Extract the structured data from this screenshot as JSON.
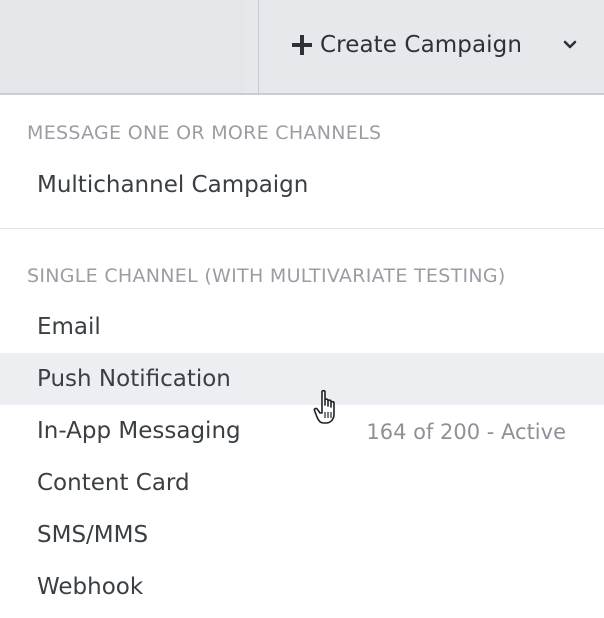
{
  "toolbar": {
    "create_label": "Create Campaign",
    "plus_icon": "plus-icon",
    "chevron_icon": "chevron-down-icon"
  },
  "menu": {
    "sections": [
      {
        "header": "MESSAGE ONE OR MORE CHANNELS",
        "items": [
          {
            "label": "Multichannel Campaign",
            "meta": ""
          }
        ]
      },
      {
        "header": "SINGLE CHANNEL (WITH MULTIVARIATE TESTING)",
        "items": [
          {
            "label": "Email",
            "meta": ""
          },
          {
            "label": "Push Notification",
            "meta": "",
            "hovered": true
          },
          {
            "label": "In-App Messaging",
            "meta": "164 of 200 - Active"
          },
          {
            "label": "Content Card",
            "meta": ""
          },
          {
            "label": "SMS/MMS",
            "meta": ""
          },
          {
            "label": "Webhook",
            "meta": ""
          }
        ]
      }
    ]
  },
  "colors": {
    "topbar_bg": "#e6e8ec",
    "hover_bg": "#eceef2",
    "header_text": "#9a9ea4",
    "item_text": "#3a3f44",
    "meta_text": "#8d9298"
  },
  "cursor": {
    "icon": "hand-pointer-icon"
  }
}
